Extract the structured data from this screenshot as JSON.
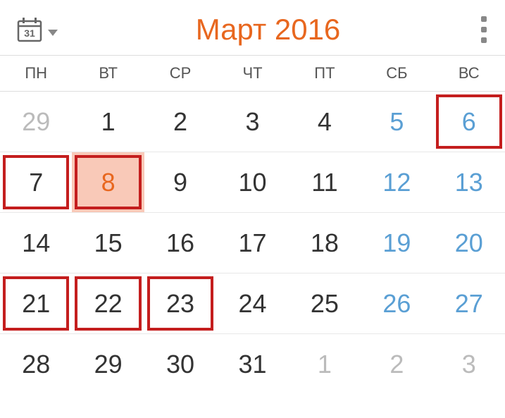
{
  "header": {
    "calendar_icon_day": "31",
    "title": "Март 2016"
  },
  "weekdays": [
    "ПН",
    "ВТ",
    "СР",
    "ЧТ",
    "ПТ",
    "СБ",
    "ВС"
  ],
  "weeks": [
    [
      {
        "day": "29",
        "other_month": true,
        "weekend": false,
        "marked": false,
        "highlighted": false
      },
      {
        "day": "1",
        "other_month": false,
        "weekend": false,
        "marked": false,
        "highlighted": false
      },
      {
        "day": "2",
        "other_month": false,
        "weekend": false,
        "marked": false,
        "highlighted": false
      },
      {
        "day": "3",
        "other_month": false,
        "weekend": false,
        "marked": false,
        "highlighted": false
      },
      {
        "day": "4",
        "other_month": false,
        "weekend": false,
        "marked": false,
        "highlighted": false
      },
      {
        "day": "5",
        "other_month": false,
        "weekend": true,
        "marked": false,
        "highlighted": false
      },
      {
        "day": "6",
        "other_month": false,
        "weekend": true,
        "marked": true,
        "highlighted": false
      }
    ],
    [
      {
        "day": "7",
        "other_month": false,
        "weekend": false,
        "marked": true,
        "highlighted": false
      },
      {
        "day": "8",
        "other_month": false,
        "weekend": false,
        "marked": false,
        "highlighted": true
      },
      {
        "day": "9",
        "other_month": false,
        "weekend": false,
        "marked": false,
        "highlighted": false
      },
      {
        "day": "10",
        "other_month": false,
        "weekend": false,
        "marked": false,
        "highlighted": false
      },
      {
        "day": "11",
        "other_month": false,
        "weekend": false,
        "marked": false,
        "highlighted": false
      },
      {
        "day": "12",
        "other_month": false,
        "weekend": true,
        "marked": false,
        "highlighted": false
      },
      {
        "day": "13",
        "other_month": false,
        "weekend": true,
        "marked": false,
        "highlighted": false
      }
    ],
    [
      {
        "day": "14",
        "other_month": false,
        "weekend": false,
        "marked": false,
        "highlighted": false
      },
      {
        "day": "15",
        "other_month": false,
        "weekend": false,
        "marked": false,
        "highlighted": false
      },
      {
        "day": "16",
        "other_month": false,
        "weekend": false,
        "marked": false,
        "highlighted": false
      },
      {
        "day": "17",
        "other_month": false,
        "weekend": false,
        "marked": false,
        "highlighted": false
      },
      {
        "day": "18",
        "other_month": false,
        "weekend": false,
        "marked": false,
        "highlighted": false
      },
      {
        "day": "19",
        "other_month": false,
        "weekend": true,
        "marked": false,
        "highlighted": false
      },
      {
        "day": "20",
        "other_month": false,
        "weekend": true,
        "marked": false,
        "highlighted": false
      }
    ],
    [
      {
        "day": "21",
        "other_month": false,
        "weekend": false,
        "marked": true,
        "highlighted": false
      },
      {
        "day": "22",
        "other_month": false,
        "weekend": false,
        "marked": true,
        "highlighted": false
      },
      {
        "day": "23",
        "other_month": false,
        "weekend": false,
        "marked": true,
        "highlighted": false
      },
      {
        "day": "24",
        "other_month": false,
        "weekend": false,
        "marked": false,
        "highlighted": false
      },
      {
        "day": "25",
        "other_month": false,
        "weekend": false,
        "marked": false,
        "highlighted": false
      },
      {
        "day": "26",
        "other_month": false,
        "weekend": true,
        "marked": false,
        "highlighted": false
      },
      {
        "day": "27",
        "other_month": false,
        "weekend": true,
        "marked": false,
        "highlighted": false
      }
    ],
    [
      {
        "day": "28",
        "other_month": false,
        "weekend": false,
        "marked": false,
        "highlighted": false
      },
      {
        "day": "29",
        "other_month": false,
        "weekend": false,
        "marked": false,
        "highlighted": false
      },
      {
        "day": "30",
        "other_month": false,
        "weekend": false,
        "marked": false,
        "highlighted": false
      },
      {
        "day": "31",
        "other_month": false,
        "weekend": false,
        "marked": false,
        "highlighted": false
      },
      {
        "day": "1",
        "other_month": true,
        "weekend": false,
        "marked": false,
        "highlighted": false
      },
      {
        "day": "2",
        "other_month": true,
        "weekend": true,
        "marked": false,
        "highlighted": false
      },
      {
        "day": "3",
        "other_month": true,
        "weekend": true,
        "marked": false,
        "highlighted": false
      }
    ]
  ]
}
